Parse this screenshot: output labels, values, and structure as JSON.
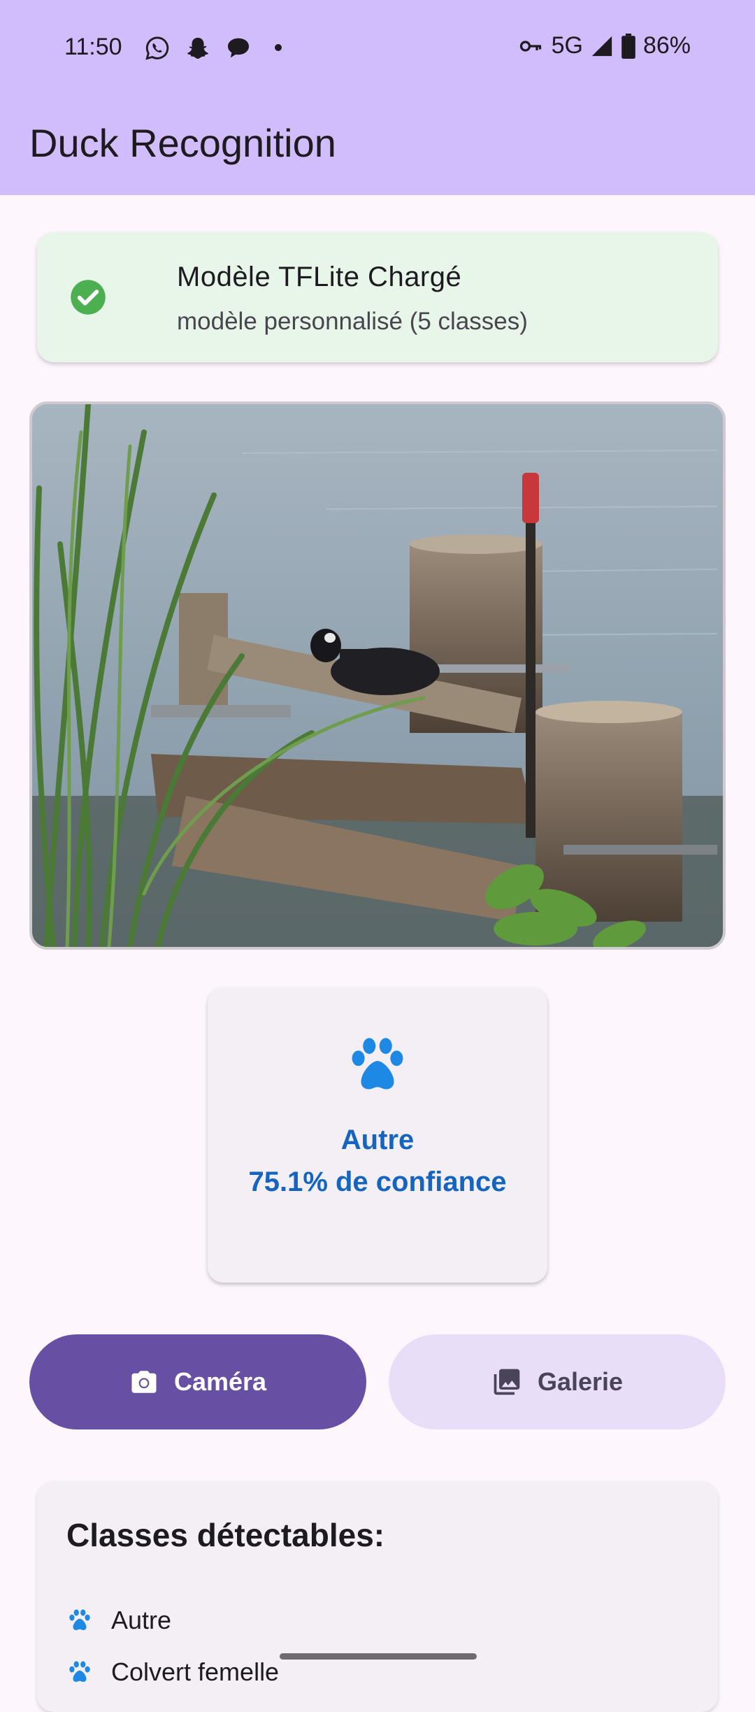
{
  "status_bar": {
    "time": "11:50",
    "network": "5G",
    "battery": "86%",
    "icons": [
      "whatsapp-icon",
      "snapchat-icon",
      "chat-bubble-icon",
      "dot-icon",
      "vpn-key-icon",
      "signal-icon",
      "battery-icon"
    ]
  },
  "app_bar": {
    "title": "Duck Recognition"
  },
  "model_status": {
    "title": "Modèle TFLite Chargé",
    "subtitle": "modèle personnalisé (5 classes)",
    "icon": "check-circle-icon",
    "color": "#4caf50"
  },
  "result": {
    "icon": "paw-icon",
    "label": "Autre",
    "confidence": "75.1% de confiance",
    "color": "#1565c0"
  },
  "buttons": {
    "camera": {
      "label": "Caméra",
      "icon": "camera-icon"
    },
    "gallery": {
      "label": "Galerie",
      "icon": "gallery-icon"
    }
  },
  "classes": {
    "heading": "Classes détectables:",
    "items": [
      "Autre",
      "Colvert femelle"
    ]
  },
  "colors": {
    "app_bar": "#d2bdfc",
    "primary": "#6750a4",
    "secondary_container": "#e8def8",
    "paw": "#1e88e5"
  }
}
